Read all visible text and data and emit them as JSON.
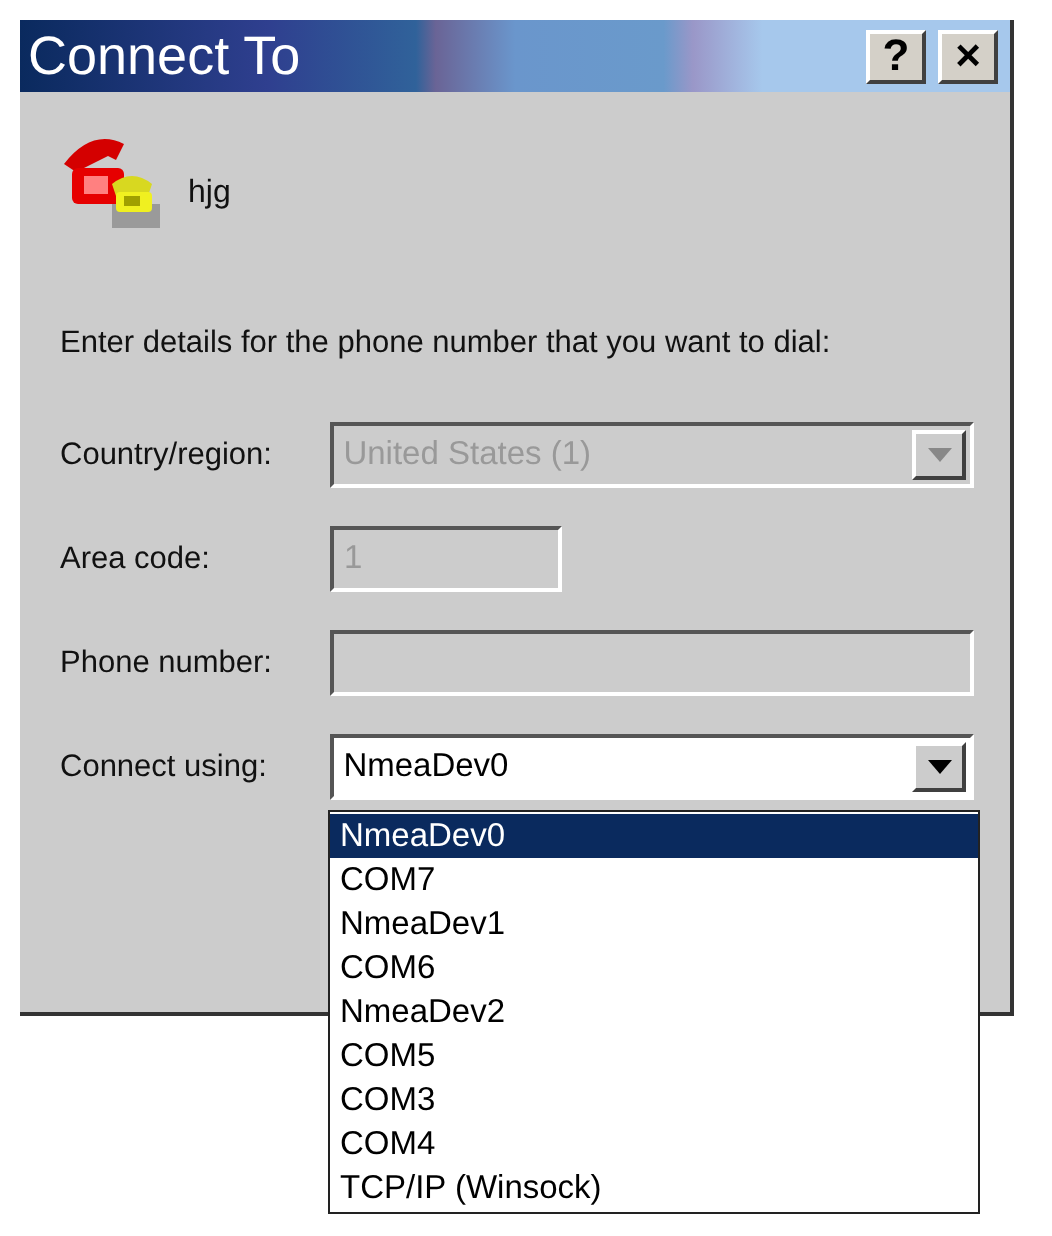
{
  "window": {
    "title": "Connect To",
    "buttons": [
      "?",
      "×"
    ]
  },
  "connection": {
    "name": "hjg"
  },
  "instructions": "Enter details for the phone number that you want to dial:",
  "fields": [
    {
      "label": "Country/region:",
      "kind": "combo",
      "value": "United States (1)",
      "disabled": true
    },
    {
      "label": "Area code:",
      "kind": "short",
      "value": "1",
      "disabled": true
    },
    {
      "label": "Phone number:",
      "kind": "text",
      "disabled": true
    },
    {
      "label": "Connect using:",
      "kind": "combo",
      "value": "NmeaDev0",
      "disabled": false,
      "expanded": true,
      "options": [
        {
          "label": "NmeaDev0",
          "selected": true
        },
        {
          "label": "COM7",
          "selected": false
        },
        {
          "label": "NmeaDev1",
          "selected": false
        },
        {
          "label": "COM6",
          "selected": false
        },
        {
          "label": "NmeaDev2",
          "selected": false
        },
        {
          "label": "COM5",
          "selected": false
        },
        {
          "label": "COM3",
          "selected": false
        },
        {
          "label": "COM4",
          "selected": false
        },
        {
          "label": "TCP/IP (Winsock)",
          "selected": false
        }
      ]
    }
  ]
}
